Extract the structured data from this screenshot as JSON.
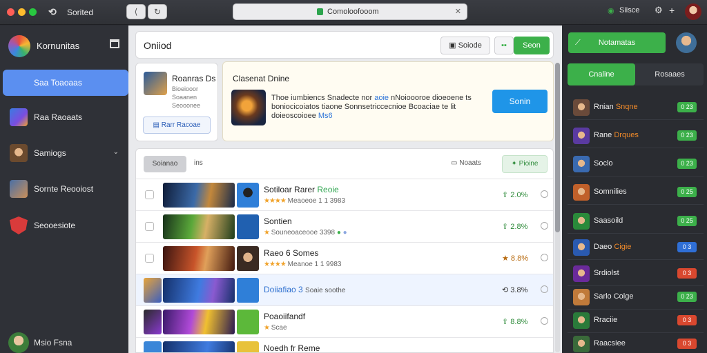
{
  "window": {
    "title": "Sorited",
    "url": "Comoloofooom",
    "right_label": "Siisce"
  },
  "sidebar": {
    "brand": "Kornunitas",
    "items": [
      {
        "label": "Saa Toaoaas",
        "active": true
      },
      {
        "label": "Raa Raoaats",
        "active": false
      },
      {
        "label": "Samiogs",
        "active": false
      },
      {
        "label": "Sornte Reooiost",
        "active": false
      },
      {
        "label": "Seooesiote",
        "active": false
      }
    ],
    "user_name": "Msio Fsna"
  },
  "main": {
    "title": "Oniiod",
    "top_buttons": {
      "outline": "Soiode",
      "green": "Seon"
    },
    "profile_card": {
      "name": "Roanras Ds",
      "sub": "Bioeiooor Soaanen Seooonee",
      "button": "Rarr Racoae"
    },
    "featured": {
      "heading": "Clasenat Dnine",
      "desc_lines": [
        "Thoe iumbiencs Snadecte nor ",
        "boniocicoiatos tiaone Sonnsetriccecnioe Bcoaciae te lit",
        "doieoscoioee "
      ],
      "desc_highlight_1": "aoie",
      "desc_tail_1": " nNoioooroe dioeoene ts",
      "desc_highlight_2": "Ms6",
      "cta": "Sonin"
    },
    "list_tools": {
      "filter": "Soianao",
      "count": "ins",
      "link": "Noaats",
      "action": "Pioine"
    },
    "rows": [
      {
        "title": "Sotiloar Rarer",
        "title_green": "Reoie",
        "stars": "★★★★",
        "meta": "Meaoeoe 1 1 3983",
        "pct": "2.0%",
        "warn": false,
        "highlight": false
      },
      {
        "title": "Sontien",
        "title_green": "",
        "stars": "★",
        "meta": "Souneoaceooe 3398",
        "pct": "2.8%",
        "warn": false,
        "highlight": false
      },
      {
        "title": "Raeo 6 Somes",
        "title_green": "",
        "stars": "★★★★",
        "meta": "Meanoe 1 1 9983",
        "pct": "8.8%",
        "warn": true,
        "highlight": false
      },
      {
        "title": "Doiiafiao 3",
        "title_green": "",
        "stars": "",
        "meta": "Soaie soothe",
        "pct": "3.8%",
        "warn": false,
        "highlight": true
      },
      {
        "title": "Poaoiifandf",
        "title_green": "",
        "stars": "★",
        "meta": "Scae",
        "pct": "8.8%",
        "warn": false,
        "highlight": false
      },
      {
        "title": "Noedh fr Reme",
        "title_green": "",
        "stars": "",
        "meta": "",
        "pct": "",
        "warn": false,
        "highlight": false
      }
    ]
  },
  "right": {
    "button": "Notamatas",
    "tabs": [
      "Cnaline",
      "Rosaaes"
    ],
    "rows": [
      {
        "name": "Rnian",
        "name_accent": "Snqne",
        "badge": "0 23",
        "badge_color": "#3cb04a"
      },
      {
        "name": "Rane",
        "name_accent": "Drques",
        "badge": "0 23",
        "badge_color": "#3cb04a"
      },
      {
        "name": "Soclo",
        "name_accent": "",
        "badge": "0 23",
        "badge_color": "#3cb04a"
      },
      {
        "name": "Somnilies",
        "name_accent": "",
        "badge": "0 25",
        "badge_color": "#3cb04a"
      },
      {
        "name": "Saasoild",
        "name_accent": "",
        "badge": "0 25",
        "badge_color": "#3cb04a"
      },
      {
        "name": "Daeo",
        "name_accent": "Cigie",
        "badge": "0 3",
        "badge_color": "#2f6fd6"
      },
      {
        "name": "Srdiolst",
        "name_accent": "",
        "badge": "0 3",
        "badge_color": "#d9482f"
      },
      {
        "name": "Sarlo Colge",
        "name_accent": "",
        "badge": "0 23",
        "badge_color": "#3cb04a"
      },
      {
        "name": "Rraciie",
        "name_accent": "",
        "badge": "0 3",
        "badge_color": "#d9482f"
      },
      {
        "name": "Raacsiee",
        "name_accent": "",
        "badge": "0 3",
        "badge_color": "#d9482f"
      }
    ]
  }
}
